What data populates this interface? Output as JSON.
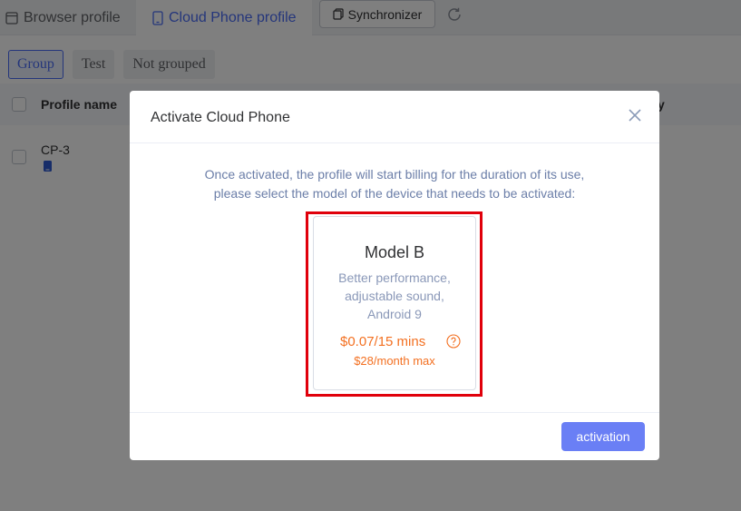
{
  "tabs": {
    "browser_profile": "Browser profile",
    "cloud_phone_profile": "Cloud Phone profile"
  },
  "toolbar": {
    "synchronizer": "Synchronizer"
  },
  "groups": [
    "Group",
    "Test",
    "Not grouped"
  ],
  "table": {
    "header_name": "Profile name",
    "header_right_fragment": "y",
    "rows": [
      {
        "name": "CP-3"
      }
    ]
  },
  "modal": {
    "title": "Activate Cloud Phone",
    "intro_line1": "Once activated, the profile will start billing for the duration of its use,",
    "intro_line2": "please select the model of the device that needs to be activated:",
    "card": {
      "title": "Model B",
      "desc_line1": "Better performance,",
      "desc_line2": "adjustable sound,",
      "desc_line3": "Android 9",
      "price": "$0.07/15 mins",
      "max": "$28/month max"
    },
    "activate_label": "activation"
  },
  "colors": {
    "accent": "#4a6cf7",
    "button": "#6a7ff5",
    "price": "#f37021",
    "highlight": "#e0000b"
  },
  "icons": {
    "browser_tab": "browser-window-icon",
    "cloud_tab": "phone-icon",
    "synchronizer": "copy-icon",
    "refresh": "refresh-icon",
    "row_device": "phone-icon",
    "close": "close-icon",
    "help": "help-circle-icon"
  }
}
